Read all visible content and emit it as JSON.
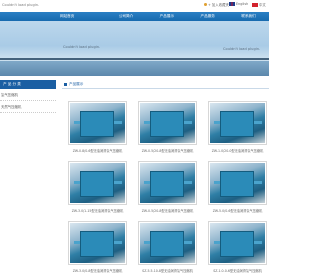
{
  "header": {
    "logo_text": "Couldn't load plugin.",
    "links": {
      "favorites": "+ 加入收藏夹",
      "english": "English",
      "chinese": "中文"
    }
  },
  "nav": {
    "items": [
      "网站首页",
      "公司简介",
      "产品展示",
      "产品服务",
      "联系我们"
    ]
  },
  "banner": {
    "plugin_left": "Couldn't load plugin.",
    "plugin_right": "Couldn't load plugin."
  },
  "sidebar": {
    "title": "产 品 分 类",
    "items": [
      "氢气压缩机",
      "天然气压缩机"
    ]
  },
  "main": {
    "title": "产品展示",
    "products": [
      {
        "caption": "ZW-0.8/0-6型无油润滑氢气压缩机"
      },
      {
        "caption": "ZW-0.5/20-8型无油润滑氢气压缩机"
      },
      {
        "caption": "ZW-1.0/20-0型无油润滑氢气压缩机"
      },
      {
        "caption": "ZW-3.0/1-15型无油润滑氢气压缩机"
      },
      {
        "caption": "ZW-0.5/20-8型无油润滑氢气压缩机"
      },
      {
        "caption": "ZW-5.0/0-6型无油润滑氢气压缩机"
      },
      {
        "caption": "ZW-3.0/0-8型无油润滑氢气压缩机"
      },
      {
        "caption": "SZ-5.5-10-8型无油润滑氢气压缩机"
      },
      {
        "caption": "SZ-1.0-0-6型无油润滑氢气压缩机"
      }
    ]
  },
  "colors": {
    "nav": "#1b6fb2",
    "side_head": "#1b5fa3",
    "accent": "#1b5fa3"
  }
}
